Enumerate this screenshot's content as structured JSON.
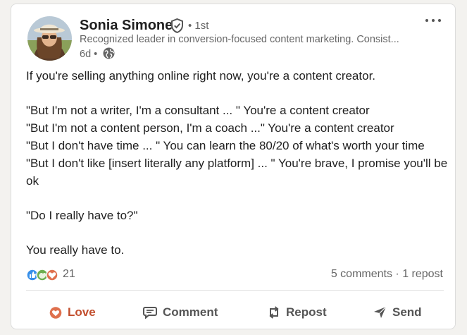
{
  "post": {
    "author": {
      "name": "Sonia Simone",
      "degree": "• 1st",
      "headline": "Recognized leader in conversion-focused content marketing. Consist...",
      "time": "6d •"
    },
    "body": {
      "p1": "If you're selling anything online right now, you're a content creator.",
      "p2_lines": [
        "\"But I'm not a writer, I'm a consultant ... \" You're a content creator",
        "\"But I'm not a content person, I'm a coach ...\" You're a content creator",
        "\"But I don't have time ... \" You can learn the 80/20 of what's worth your time",
        "\"But I don't like [insert literally any platform] ... \" You're brave, I promise you'll be ok"
      ],
      "p3": "\"Do I really have to?\"",
      "p4": "You really have to."
    },
    "social": {
      "reaction_count": "21",
      "comments": "5 comments",
      "separator": " · ",
      "reposts": "1 repost",
      "reactions": [
        "like-icon",
        "support-icon",
        "love-icon"
      ]
    },
    "actions": {
      "love": "Love",
      "comment": "Comment",
      "repost": "Repost",
      "send": "Send"
    },
    "colors": {
      "love_active": "#c24e2d",
      "like": "#378fe9",
      "support": "#6dae4f",
      "love": "#df704d",
      "text": "#1f1f1f",
      "secondary": "#666666"
    }
  }
}
